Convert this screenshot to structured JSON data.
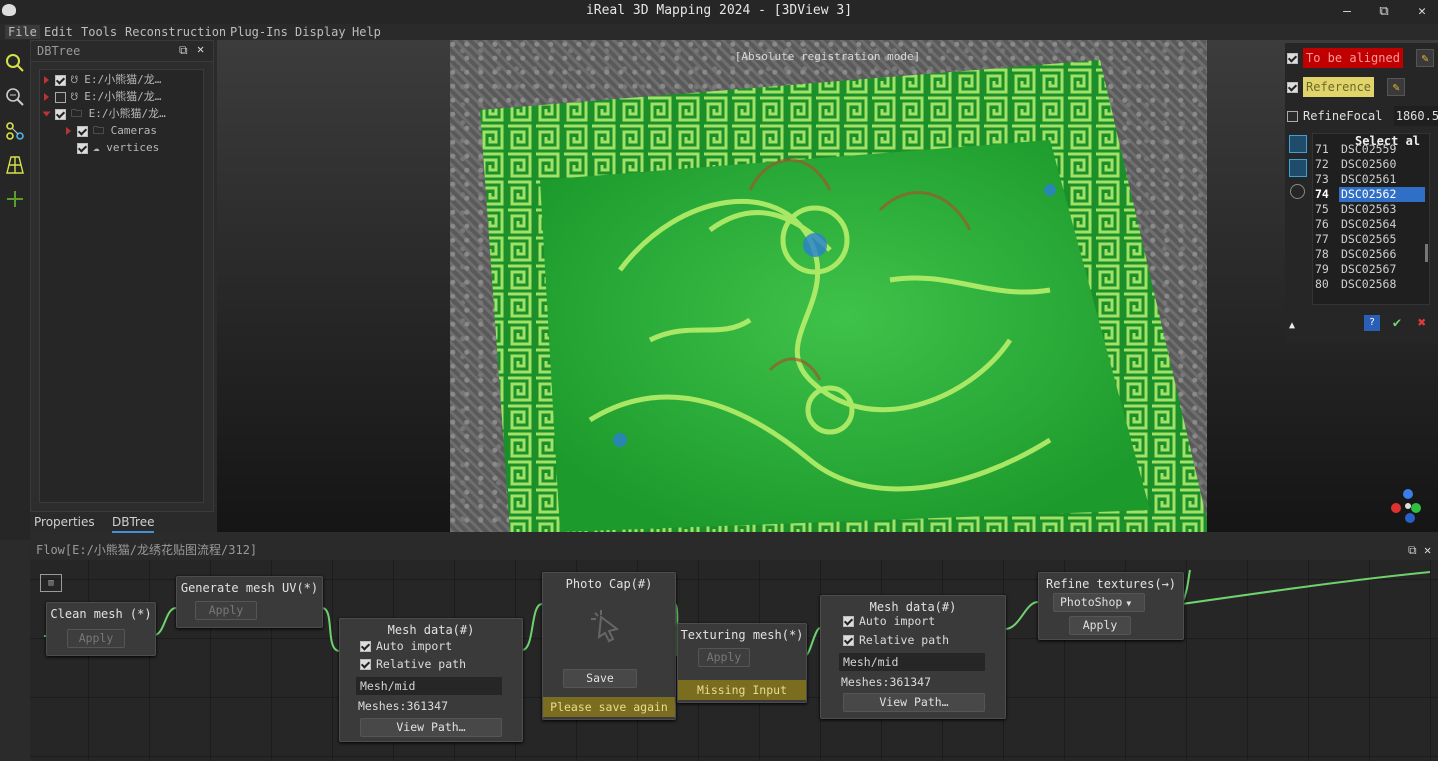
{
  "window": {
    "title": "iReal 3D Mapping 2024 - [3DView 3]",
    "controls": [
      "—",
      "⧉",
      "✕"
    ]
  },
  "menu": [
    "File",
    "Edit",
    "Tools",
    "Reconstruction",
    "Plug-Ins",
    "Display",
    "Help"
  ],
  "dbtree": {
    "title": "DBTree",
    "items": [
      {
        "label": "E:/小熊猫/龙…",
        "checked": true
      },
      {
        "label": "E:/小熊猫/龙…",
        "checked": false
      },
      {
        "label": "E:/小熊猫/龙…",
        "checked": true
      },
      {
        "label": "Cameras",
        "checked": true
      },
      {
        "label": "vertices",
        "checked": true
      }
    ],
    "tabs": [
      "Properties",
      "DBTree"
    ]
  },
  "view": {
    "mode_label": "[Absolute registration mode]"
  },
  "align_panel": {
    "to_be_aligned": "To be aligned",
    "reference": "Reference",
    "refine_focal_label": "RefineFocal",
    "refine_focal_value": "1860.54",
    "select_all": "Select al",
    "images": [
      {
        "n": "71",
        "name": "DSC02559"
      },
      {
        "n": "72",
        "name": "DSC02560"
      },
      {
        "n": "73",
        "name": "DSC02561"
      },
      {
        "n": "74",
        "name": "DSC02562",
        "selected": true
      },
      {
        "n": "75",
        "name": "DSC02563"
      },
      {
        "n": "76",
        "name": "DSC02564"
      },
      {
        "n": "77",
        "name": "DSC02565"
      },
      {
        "n": "78",
        "name": "DSC02566"
      },
      {
        "n": "79",
        "name": "DSC02567"
      },
      {
        "n": "80",
        "name": "DSC02568"
      }
    ],
    "colors": {
      "to_be_aligned": "#c00000",
      "reference": "#e1d46a",
      "selected": "#2f6fc6"
    }
  },
  "flow": {
    "title": "Flow[E:/小熊猫/龙绣花贴图流程/312]",
    "nodes": {
      "clean_mesh": {
        "title": "Clean mesh (*)",
        "apply": "Apply"
      },
      "gen_uv": {
        "title": "Generate mesh UV(*)",
        "apply": "Apply"
      },
      "mesh_data_1": {
        "title": "Mesh data(#)",
        "auto_import": "Auto import",
        "relative_path": "Relative path",
        "path": "Mesh/mid",
        "meshes": "Meshes:361347",
        "view_path": "View Path…"
      },
      "photo_cap": {
        "title": "Photo Cap(#)",
        "save": "Save",
        "warning": "Please save again"
      },
      "texturing": {
        "title": "Texturing mesh(*)",
        "apply": "Apply",
        "warning": "Missing Input"
      },
      "mesh_data_2": {
        "title": "Mesh data(#)",
        "auto_import": "Auto import",
        "relative_path": "Relative path",
        "path": "Mesh/mid",
        "meshes": "Meshes:361347",
        "view_path": "View Path…"
      },
      "refine": {
        "title": "Refine textures(→)",
        "dropdown": "PhotoShop",
        "apply": "Apply"
      }
    }
  }
}
